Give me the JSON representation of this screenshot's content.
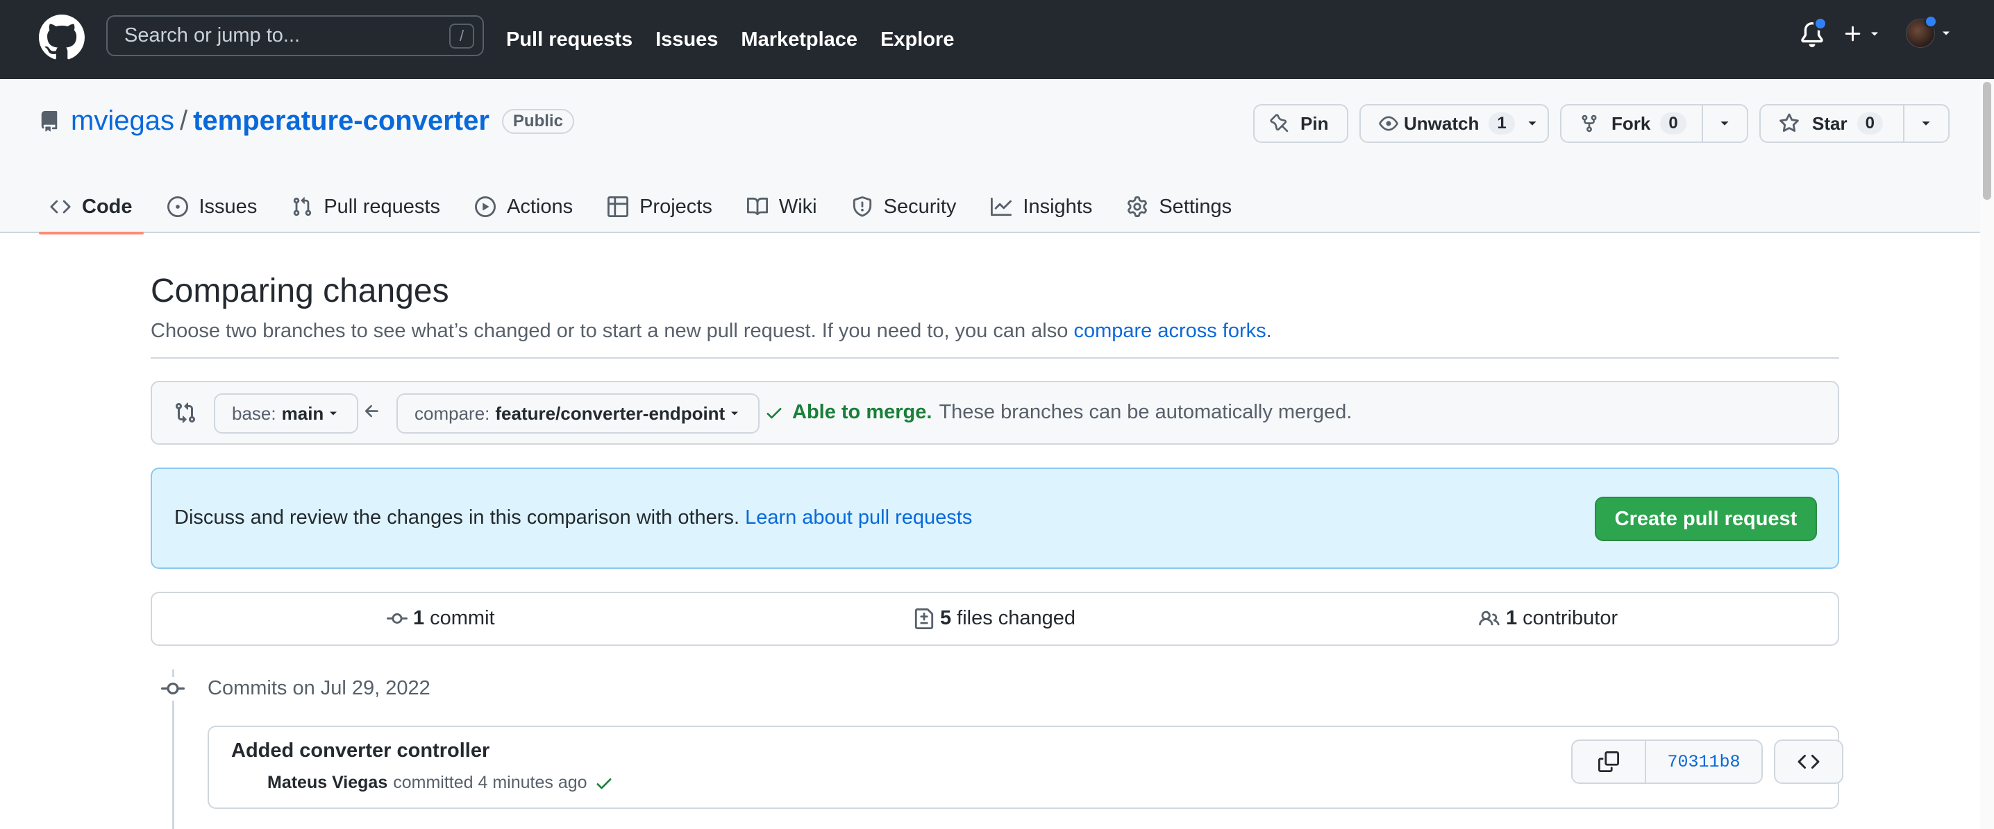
{
  "header": {
    "search_placeholder": "Search or jump to...",
    "search_shortcut": "/",
    "nav": [
      "Pull requests",
      "Issues",
      "Marketplace",
      "Explore"
    ],
    "icons": [
      "github-logo",
      "bell-icon",
      "plus-icon",
      "avatar"
    ]
  },
  "repo": {
    "owner": "mviegas",
    "separator": "/",
    "name": "temperature-converter",
    "visibility": "Public",
    "actions": {
      "pin_label": "Pin",
      "watch_label": "Unwatch",
      "watch_count": "1",
      "fork_label": "Fork",
      "fork_count": "0",
      "star_label": "Star",
      "star_count": "0"
    },
    "tabs": [
      {
        "label": "Code",
        "icon": "code-icon",
        "active": true
      },
      {
        "label": "Issues",
        "icon": "issue-icon"
      },
      {
        "label": "Pull requests",
        "icon": "pull-request-icon"
      },
      {
        "label": "Actions",
        "icon": "play-icon"
      },
      {
        "label": "Projects",
        "icon": "table-icon"
      },
      {
        "label": "Wiki",
        "icon": "book-icon"
      },
      {
        "label": "Security",
        "icon": "shield-icon"
      },
      {
        "label": "Insights",
        "icon": "graph-icon"
      },
      {
        "label": "Settings",
        "icon": "gear-icon"
      }
    ]
  },
  "compare": {
    "title": "Comparing changes",
    "desc_before": "Choose two branches to see what’s changed or to start a new pull request. If you need to, you can also ",
    "desc_link": "compare across forks",
    "desc_after": ".",
    "base_label": "base:",
    "base_value": "main",
    "compare_label": "compare:",
    "compare_value": "feature/converter-endpoint",
    "merge_ok": "Able to merge.",
    "merge_note": "These branches can be automatically merged."
  },
  "flash": {
    "text": "Discuss and review the changes in this comparison with others. ",
    "link": "Learn about pull requests",
    "button": "Create pull request"
  },
  "summary": {
    "commits_num": "1",
    "commits_label": "commit",
    "files_num": "5",
    "files_label": "files changed",
    "contributors_num": "1",
    "contributors_label": "contributor"
  },
  "commits": {
    "date_header": "Commits on Jul 29, 2022",
    "items": [
      {
        "message": "Added converter controller",
        "author": "Mateus Viegas",
        "action": "committed 4 minutes ago",
        "sha": "70311b8"
      }
    ]
  },
  "colors": {
    "header_bg": "#24292f",
    "link": "#0969da",
    "success": "#1a7f37",
    "primary_button": "#2da44e",
    "active_tab_underline": "#fd8c73",
    "flash_bg": "#ddf4ff"
  }
}
